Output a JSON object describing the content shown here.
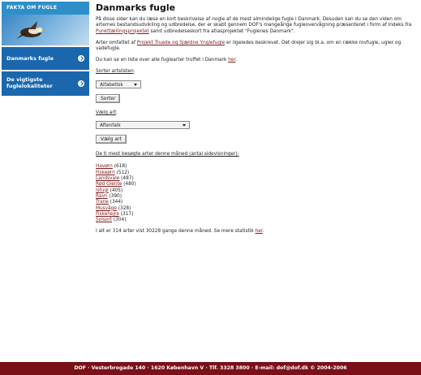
{
  "sidebar": {
    "header": "FAKTA OM FUGLE",
    "items": [
      {
        "label": "Danmarks fugle"
      },
      {
        "label": "De vigtigste fuglelokaliteter"
      }
    ]
  },
  "main": {
    "title": "Danmarks fugle",
    "intro": {
      "text_1": "På disse sider kan du læse en kort beskrivelse af nogle af de mest almindelige fugle i Danmark. Desuden kan du se den viden om arternes bestandsudvikling og udbredelse, der er skabt gennem DOF's mangeårige fugleovervågning præsenteret i form af indeks fra ",
      "link": "Punkttællingsprojektet",
      "text_2": " samt udbredelseskort fra atlasprojektet \"Fuglenes Danmark\"."
    },
    "para2": {
      "text_1": "Arter omfattet af ",
      "link": "Projekt Truede og Sjældne Ynglefugle",
      "text_2": " er ligeledes beskrevet. Det drejer sig bl.a. om en række rovfugle, ugler og vadefugle."
    },
    "para3": {
      "text": "Du kan se en liste over alle fuglearter truffet i Danmark ",
      "link": "her",
      "end": "."
    },
    "sort": {
      "label": "Sorter artslisten",
      "colon": ":",
      "selected": "Alfabetisk",
      "button": "Sorter"
    },
    "species": {
      "label": "Vælg art",
      "colon": ":",
      "selected": "Aftenfalk",
      "button": "Vælg art"
    },
    "top_heading": "De ti mest besøgte arter denne måned (antal sidevisninger):",
    "top": [
      {
        "name": "Havørn",
        "count": " (618)"
      },
      {
        "name": "Fiskeørn",
        "count": " (512)"
      },
      {
        "name": "Landsvale",
        "count": " (487)"
      },
      {
        "name": "Rød Glente",
        "count": " (480)"
      },
      {
        "name": "Isfugl",
        "count": " (405)"
      },
      {
        "name": "Ravn",
        "count": " (390)"
      },
      {
        "name": "Trane",
        "count": " (344)"
      },
      {
        "name": "Musvåge",
        "count": " (328)"
      },
      {
        "name": "Fiskehejre",
        "count": " (317)"
      },
      {
        "name": "Solsort",
        "count": " (304)"
      }
    ],
    "summary": {
      "text": "I alt er 314 arter vist 30228 gange denne måned. Se mere statistik ",
      "link": "her",
      "end": "."
    }
  },
  "footer": {
    "text": "DOF · Vesterbrogade 140 · 1620 København V · Tlf. 3328 3800 · E-mail: dof@dof.dk © 2004-2006"
  },
  "colors": {
    "sidebar_header": "#2e8fc8",
    "sidebar_item": "#1a67ad",
    "link": "#7a1c1c",
    "footer": "#7a1018"
  }
}
